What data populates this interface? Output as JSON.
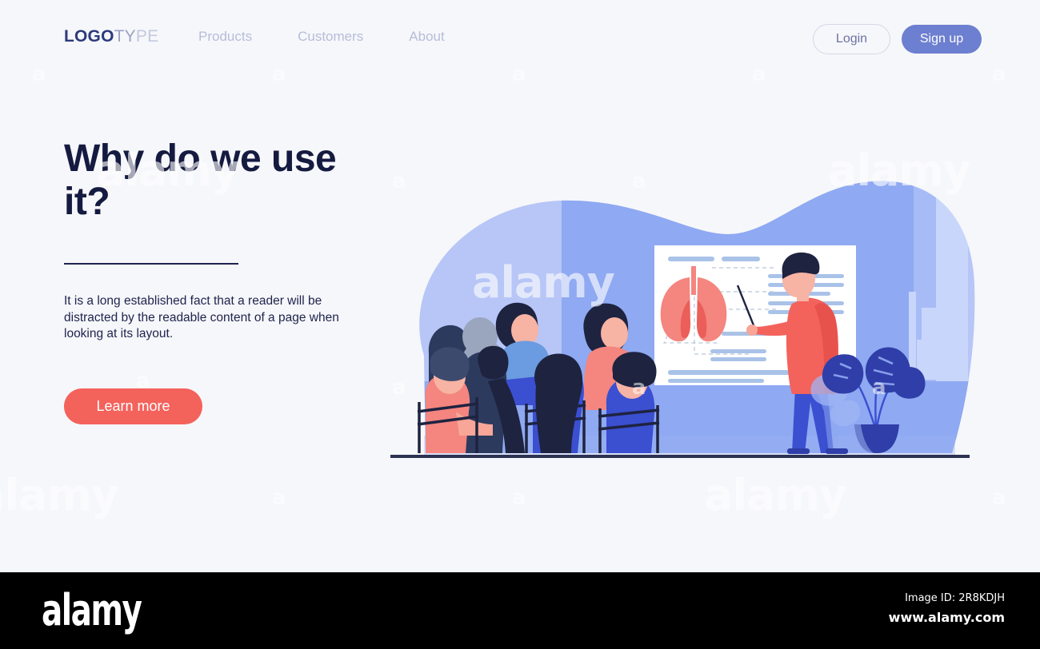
{
  "header": {
    "logo": {
      "bold": "LOGO",
      "mid": "TY",
      "light": "PE"
    },
    "nav": [
      {
        "label": "Products"
      },
      {
        "label": "Customers"
      },
      {
        "label": "About"
      }
    ],
    "login_label": "Login",
    "signup_label": "Sign up"
  },
  "hero": {
    "title": "Why do we use it?",
    "body": "It is a long established fact that a reader will be distracted by the readable content of a page when looking at its layout.",
    "cta_label": "Learn more"
  },
  "illustration": {
    "scene": "medical-lecture-presentation",
    "description": "Doctor pointing with a pointer at a lung diagram on a whiteboard while a seated audience watches",
    "elements": [
      "background-blob",
      "city-skyline",
      "whiteboard",
      "lung-diagram",
      "presenter",
      "audience",
      "potted-plant",
      "floor-line"
    ]
  },
  "footer": {
    "brand": "alamy",
    "image_id": "Image ID: 2R8KDJH",
    "url": "www.alamy.com"
  },
  "watermark": {
    "big": "alamy",
    "small": "a"
  },
  "colors": {
    "page_bg": "#f6f7fa",
    "heading": "#151a40",
    "nav_link": "#b6bdd9",
    "accent_blue": "#6d7fd0",
    "accent_coral": "#f4625c",
    "blob_blue": "#8fa9f2",
    "blob_blue_light": "#b7c6f7",
    "lung_pink": "#f4857f",
    "footer_bg": "#000000"
  }
}
